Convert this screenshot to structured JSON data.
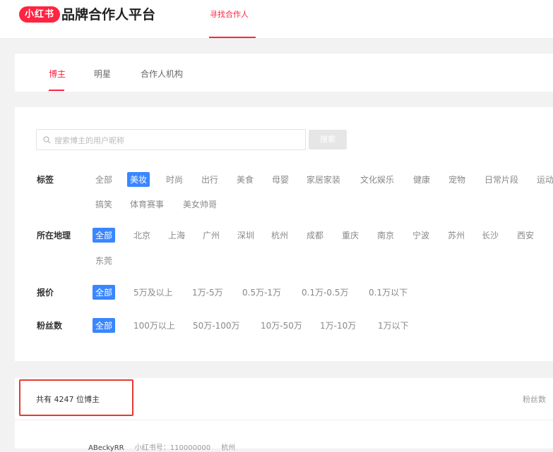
{
  "header": {
    "logo": "小红书",
    "title": "品牌合作人平台",
    "nav_tab": "寻找合作人"
  },
  "subtabs": [
    "博主",
    "明星",
    "合作人机构"
  ],
  "search": {
    "placeholder": "搜索博主的用户昵称",
    "button": "搜索"
  },
  "filters": {
    "tags": {
      "label": "标签",
      "options": [
        "全部",
        "美妆",
        "时尚",
        "出行",
        "美食",
        "母婴",
        "家居家装",
        "文化娱乐",
        "健康",
        "宠物",
        "日常片段",
        "运动",
        "搞笑",
        "体育赛事",
        "美女帅哥"
      ],
      "selected": "美妆"
    },
    "location": {
      "label": "所在地理",
      "options": [
        "全部",
        "北京",
        "上海",
        "广州",
        "深圳",
        "杭州",
        "成都",
        "重庆",
        "南京",
        "宁波",
        "苏州",
        "长沙",
        "西安",
        "东莞"
      ],
      "selected": "全部"
    },
    "price": {
      "label": "报价",
      "options": [
        "全部",
        "5万及以上",
        "1万-5万",
        "0.5万-1万",
        "0.1万-0.5万",
        "0.1万以下"
      ],
      "selected": "全部"
    },
    "fans": {
      "label": "粉丝数",
      "options": [
        "全部",
        "100万以上",
        "50万-100万",
        "10万-50万",
        "1万-10万",
        "1万以下"
      ],
      "selected": "全部"
    }
  },
  "results": {
    "count_text": "共有 4247 位博主",
    "sort_label": "粉丝数",
    "first_row": {
      "name": "ABeckyRR",
      "id_text": "小红书号：110000000",
      "city": "杭州"
    }
  },
  "colors": {
    "brand": "#ff2442",
    "selected": "#3a86ff",
    "highlight_box": "#e33b2f"
  }
}
